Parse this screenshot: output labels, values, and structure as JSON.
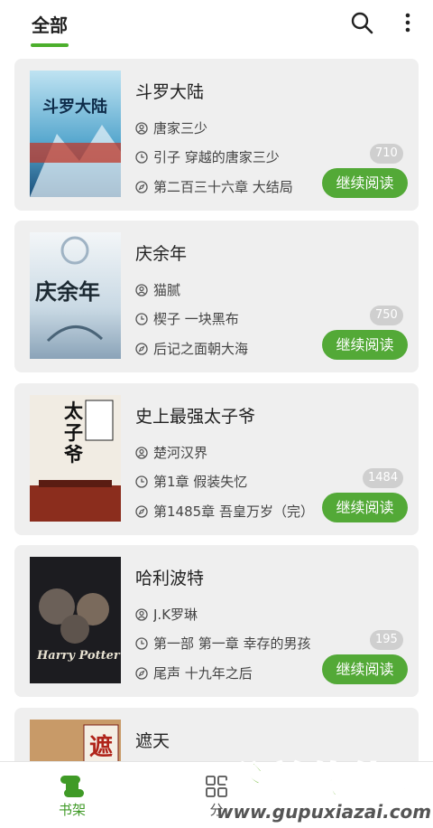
{
  "header": {
    "tab_all": "全部",
    "search_icon": "search-icon",
    "more_icon": "more-vertical-icon"
  },
  "colors": {
    "accent": "#53a937",
    "card_bg": "#efefef",
    "badge_bg": "#cfcfcf"
  },
  "books": [
    {
      "title": "斗罗大陆",
      "author": "唐家三少",
      "current_chapter": "引子 穿越的唐家三少",
      "latest_chapter": "第二百三十六章 大结局",
      "count": "710",
      "button": "继续阅读",
      "cover_text": "斗罗大陆"
    },
    {
      "title": "庆余年",
      "author": "猫腻",
      "current_chapter": "楔子 一块黑布",
      "latest_chapter": "后记之面朝大海",
      "count": "750",
      "button": "继续阅读",
      "cover_text": "庆余年"
    },
    {
      "title": "史上最强太子爷",
      "author": "楚河汉界",
      "current_chapter": "第1章 假装失忆",
      "latest_chapter": "第1485章 吾皇万岁（完）",
      "count": "1484",
      "button": "继续阅读",
      "cover_text": "太子爷"
    },
    {
      "title": "哈利波特",
      "author": "J.K罗琳",
      "current_chapter": "第一部 第一章 幸存的男孩",
      "latest_chapter": "尾声 十九年之后",
      "count": "195",
      "button": "继续阅读",
      "cover_text": "Harry Potter"
    },
    {
      "title": "遮天",
      "cover_text": "遮"
    }
  ],
  "bottom_nav": {
    "shelf_label": "书架",
    "category_label": "分"
  },
  "watermark": {
    "text": "谷普软件园",
    "url": "www.gupuxiazai.com"
  }
}
